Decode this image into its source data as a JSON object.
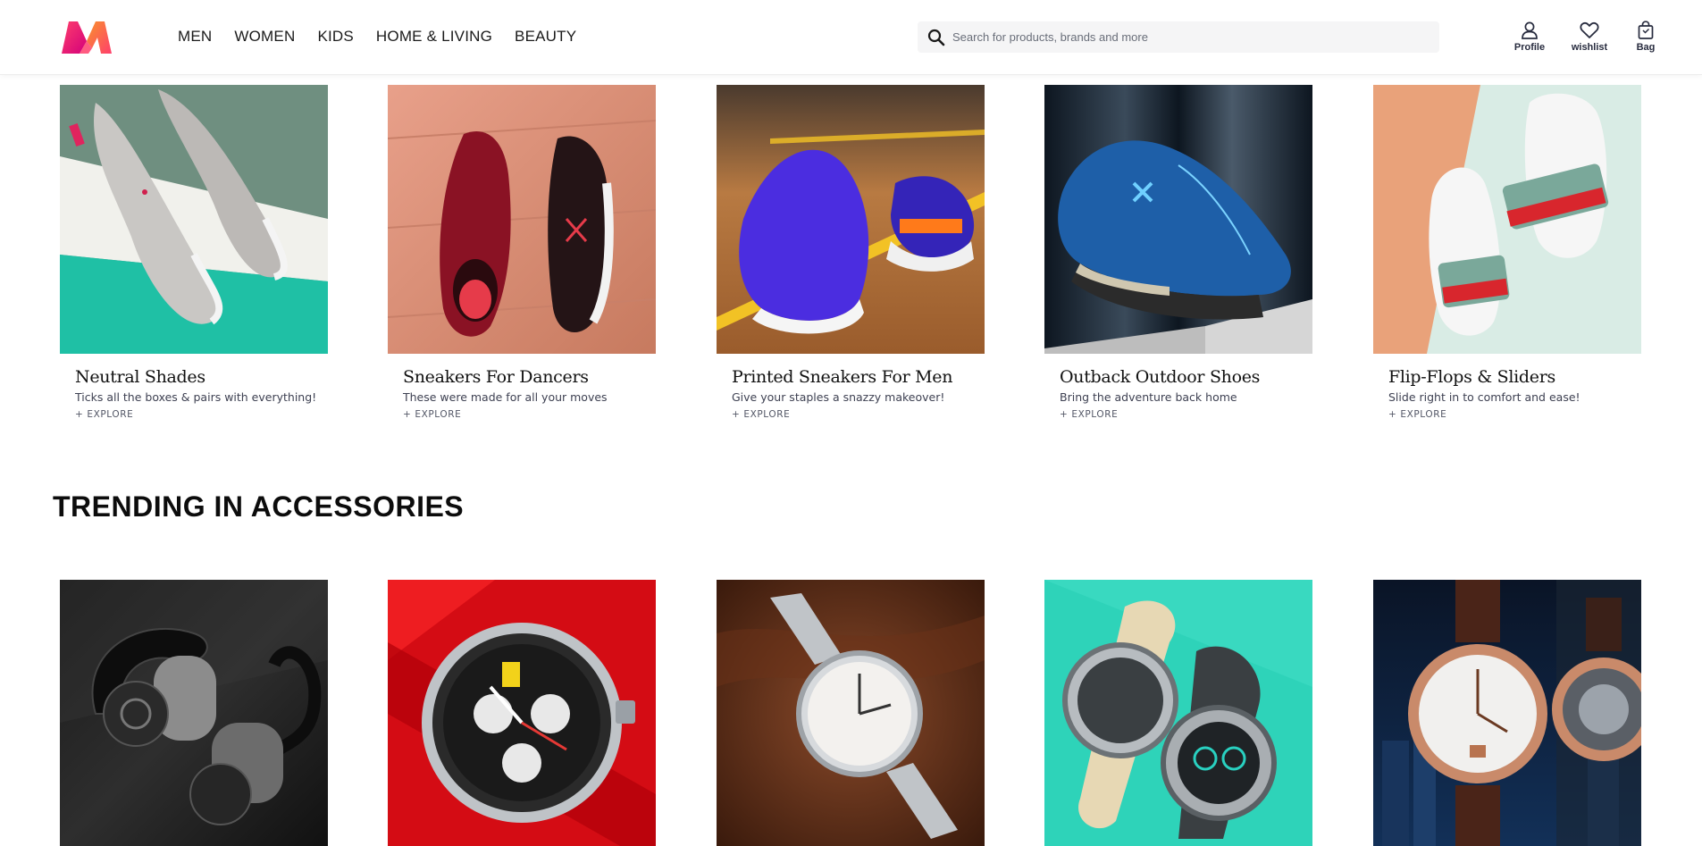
{
  "header": {
    "logo_icon": "myntra-m-logo-icon",
    "nav": [
      "MEN",
      "WOMEN",
      "KIDS",
      "HOME & LIVING",
      "BEAUTY"
    ],
    "search": {
      "placeholder": "Search for products, brands and more",
      "value": ""
    },
    "actions": [
      {
        "icon": "profile-icon",
        "label": "Profile"
      },
      {
        "icon": "heart-icon",
        "label": "wishlist"
      },
      {
        "icon": "bag-icon",
        "label": "Bag"
      }
    ]
  },
  "footwear": [
    {
      "title": "Neutral Shades",
      "subtitle": "Ticks all the boxes & pairs with everything!",
      "cta": "+ EXPLORE"
    },
    {
      "title": "Sneakers For Dancers",
      "subtitle": "These were made for all your moves",
      "cta": "+ EXPLORE"
    },
    {
      "title": "Printed Sneakers For Men",
      "subtitle": "Give your staples a snazzy makeover!",
      "cta": "+ EXPLORE"
    },
    {
      "title": "Outback Outdoor Shoes",
      "subtitle": "Bring the adventure back home",
      "cta": "+ EXPLORE"
    },
    {
      "title": "Flip-Flops & Sliders",
      "subtitle": "Slide right in to comfort and ease!",
      "cta": "+ EXPLORE"
    }
  ],
  "accessories_section": {
    "title": "TRENDING IN ACCESSORIES"
  },
  "colors": {
    "brand_pink": "#ff3f6c",
    "brand_orange": "#f8922c",
    "brand_magenta": "#d3007b"
  }
}
